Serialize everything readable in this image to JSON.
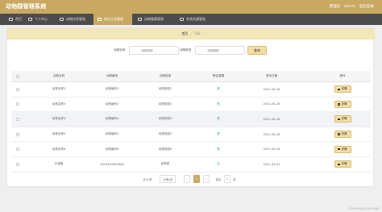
{
  "header": {
    "title": "动物园管理系统",
    "user": "管理员",
    "username": "admin",
    "logout": "退出登录"
  },
  "nav": [
    {
      "label": "首页"
    },
    {
      "label": "个人中心"
    },
    {
      "label": "动物信息管理"
    },
    {
      "label": "测试工作管理",
      "active": true
    },
    {
      "label": "动物健康管理"
    },
    {
      "label": "系统关键管理"
    }
  ],
  "breadcrumb": {
    "home": "首页",
    "separator": "/",
    "current": "列表"
  },
  "search": {
    "field1_label": "动物名称",
    "field1_placeholder": "动物名称",
    "field2_label": "动物类型",
    "field2_placeholder": "动物类型",
    "button": "查询"
  },
  "table": {
    "headers": [
      "动物名称",
      "动物编号",
      "动物类型",
      "是否健康",
      "发布日期",
      "操作"
    ],
    "rows": [
      [
        "动物名称2",
        "动物编号2",
        "动物类型2",
        "是",
        "2021-04-26",
        "详情"
      ],
      [
        "动物名称3",
        "动物编号3",
        "动物类型3",
        "是",
        "2021-04-26",
        "详情"
      ],
      [
        "动物名称4",
        "动物编号4",
        "动物类型4",
        "是",
        "2021-04-26",
        "详情"
      ],
      [
        "动物名称5",
        "动物编号5",
        "动物类型5",
        "是",
        "2021-04-26",
        "详情"
      ],
      [
        "动物名称6",
        "动物编号6",
        "动物类型6",
        "是",
        "2021-04-26",
        "详情"
      ],
      [
        "长颈鹿",
        "1619425461648",
        "食草类",
        "否",
        "2021-05-01",
        "详情"
      ]
    ]
  },
  "pagination": {
    "total": "共 6 条",
    "page_size": "10条/页",
    "prev": "‹",
    "current": "1",
    "next": "›",
    "goto": "前往",
    "page_input": "1",
    "page_unit": "页"
  },
  "footer": {
    "watermark": "CSDN @QQ1974123863"
  },
  "colors": {
    "primary": "#c9a962",
    "nav_bg": "#4c4c4c",
    "crumb_bg": "#f3e6b8",
    "button_bg": "#f3dfa6",
    "yes_green": "#37b26c"
  },
  "icons": [
    "home-icon",
    "user-icon",
    "list-icon",
    "detail-icon"
  ]
}
